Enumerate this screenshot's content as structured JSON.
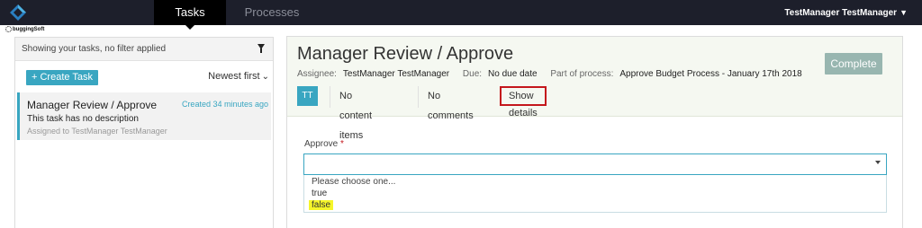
{
  "navbar": {
    "tabs": [
      {
        "label": "Tasks",
        "active": true
      },
      {
        "label": "Processes",
        "active": false
      }
    ],
    "user": "TestManager TestManager",
    "bg_color": "#1d1f2b"
  },
  "watermark": {
    "text": "buggingSoft"
  },
  "task_list": {
    "filter_text": "Showing your tasks, no filter applied",
    "create_button": "+ Create Task",
    "sort_label": "Newest first",
    "items": [
      {
        "title": "Manager Review / Approve",
        "created": "Created 34 minutes ago",
        "description": "This task has no description",
        "assigned": "Assigned to TestManager TestManager"
      }
    ]
  },
  "task_detail": {
    "title": "Manager Review / Approve",
    "assignee_label": "Assignee:",
    "assignee": "TestManager TestManager",
    "due_label": "Due:",
    "due": "No due date",
    "process_label": "Part of process:",
    "process": "Approve Budget Process - January 17th 2018",
    "complete_button": "Complete",
    "avatar_initials": "TT",
    "content_tab": "No content items",
    "comments_tab": "No comments",
    "details_tab": "Show details",
    "accent_color": "#39a6c1",
    "highlight_color": "#c4161c"
  },
  "form": {
    "field_label": "Approve",
    "required_mark": "*",
    "selected_value": "",
    "options": [
      "Please choose one...",
      "true",
      "false"
    ]
  }
}
